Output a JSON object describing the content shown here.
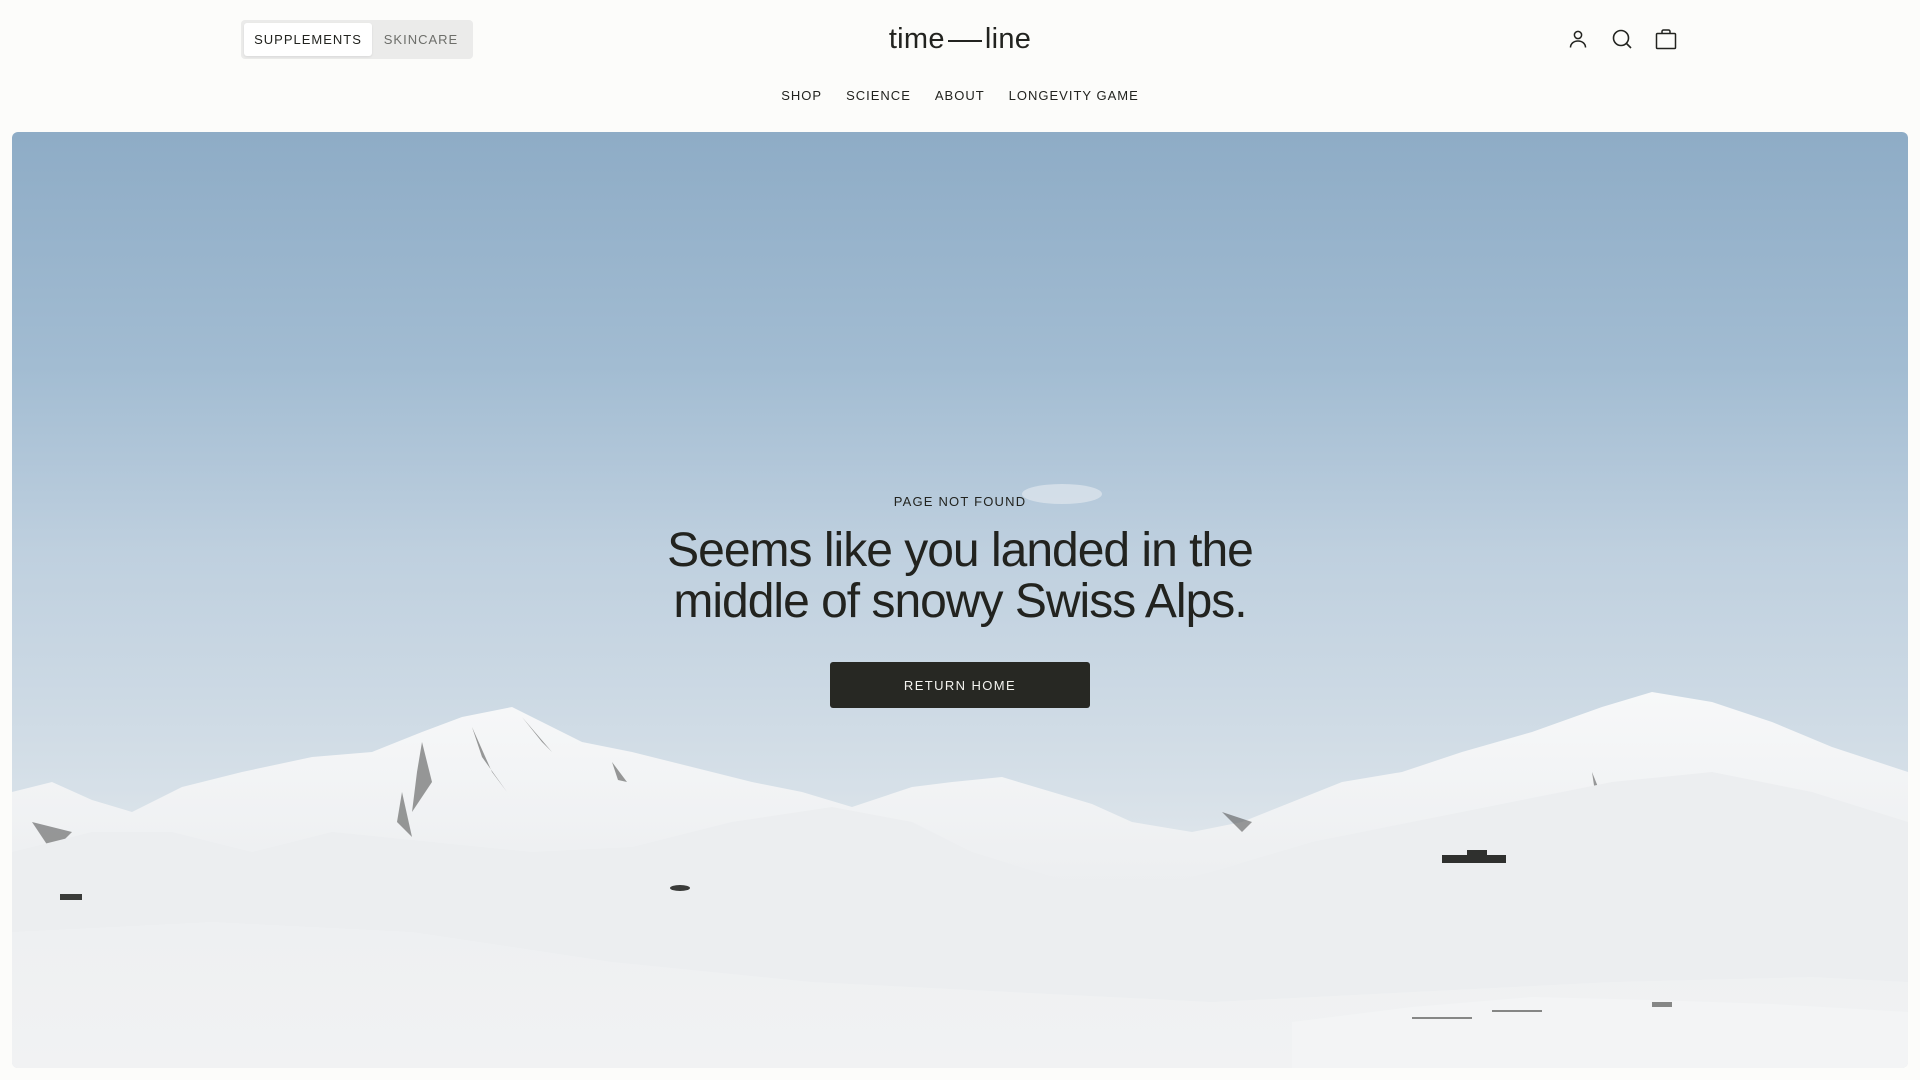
{
  "brand": {
    "logo_left": "time",
    "logo_right": "line"
  },
  "category_toggle": {
    "items": [
      {
        "label": "SUPPLEMENTS",
        "active": true
      },
      {
        "label": "SKINCARE",
        "active": false
      }
    ]
  },
  "nav": {
    "items": [
      "SHOP",
      "SCIENCE",
      "ABOUT",
      "LONGEVITY GAME"
    ]
  },
  "header_icons": [
    "account-icon",
    "search-icon",
    "cart-icon"
  ],
  "hero": {
    "eyebrow": "PAGE NOT FOUND",
    "headline_line1": "Seems like you landed in the",
    "headline_line2": "middle of snowy Swiss Alps.",
    "cta_label": "RETURN HOME"
  },
  "colors": {
    "text": "#22231f",
    "button_bg": "#272823",
    "button_text": "#f4f4f0",
    "sky_top": "#8eacc6",
    "snow": "#f2f3f4"
  }
}
